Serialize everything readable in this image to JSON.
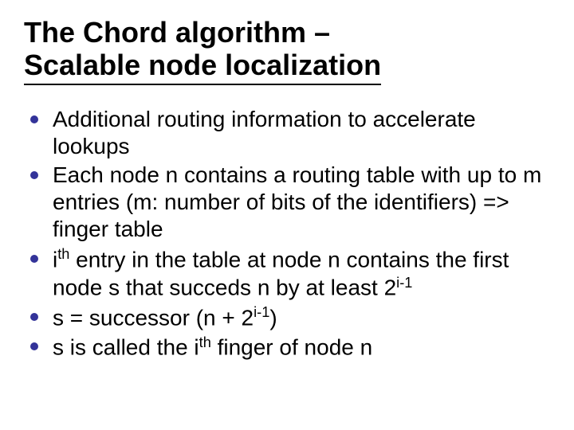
{
  "title_line1": "The Chord algorithm –",
  "title_line2": "Scalable node localization",
  "bullets": {
    "b0": "Additional routing information to accelerate lookups",
    "b1": "Each node n contains a routing table with up to m entries (m: number of bits of the identifiers) => finger table",
    "b2_p1": "i",
    "b2_sup1": "th",
    "b2_p2": " entry in the table at node n contains the first node s that succeds n by at least 2",
    "b2_sup2": "i-1",
    "b3_p1": "s = successor (n + 2",
    "b3_sup1": "i-1",
    "b3_p2": ")",
    "b4_p1": "s is called the i",
    "b4_sup1": "th",
    "b4_p2": " finger of node n"
  }
}
